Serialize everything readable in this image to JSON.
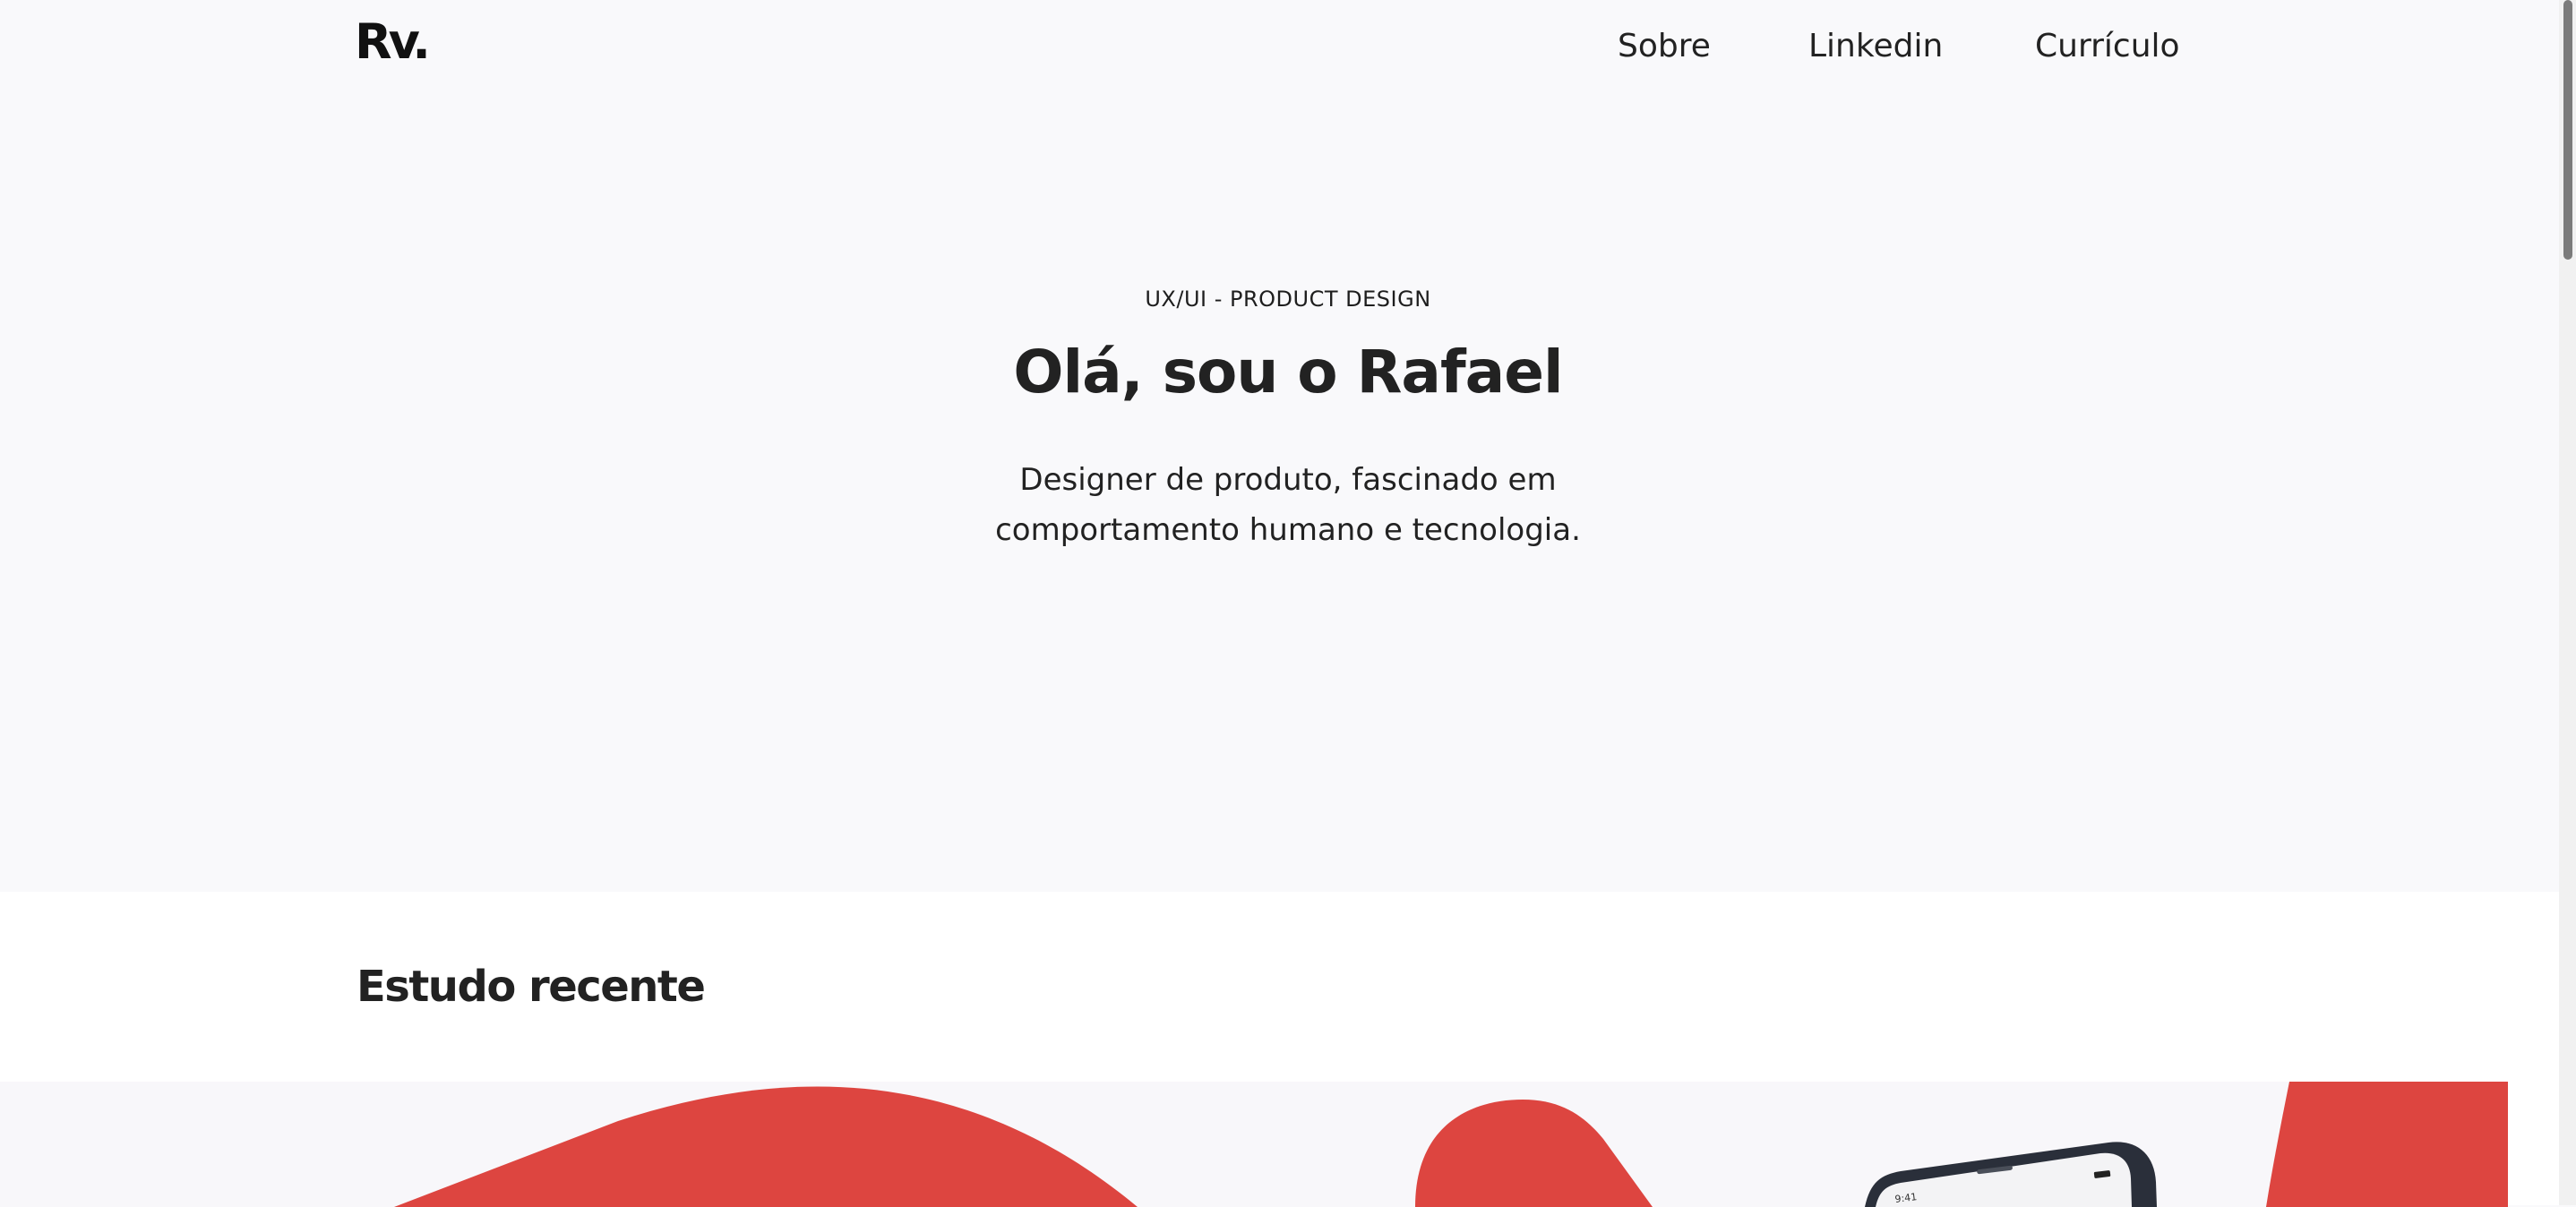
{
  "header": {
    "logo": "Rv.",
    "nav": [
      "Sobre",
      "Linkedin",
      "Currículo"
    ]
  },
  "hero": {
    "eyebrow": "UX/UI - PRODUCT DESIGN",
    "title": "Olá, sou o Rafael",
    "description_line1": "Designer de produto, fascinado em",
    "description_line2": "comportamento humano e tecnologia."
  },
  "recent": {
    "title": "Estudo recente",
    "phone_time": "9:41"
  },
  "colors": {
    "accent": "#dd4540",
    "background": "#f9f9fb",
    "text": "#222222",
    "phone_frame": "#2a2f3a"
  }
}
